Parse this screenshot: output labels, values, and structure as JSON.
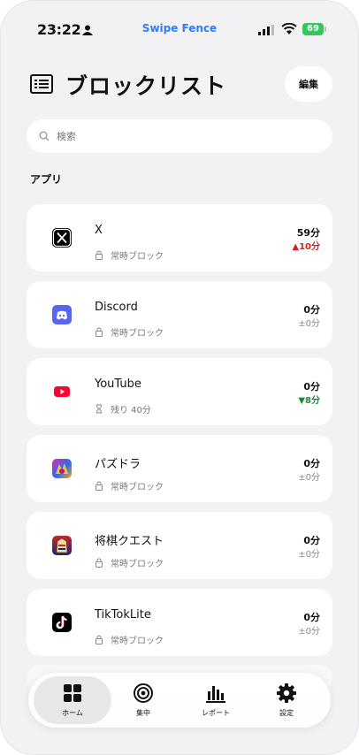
{
  "status_bar": {
    "time": "23:22",
    "carrier_brand": "Swipe Fence",
    "battery": "69",
    "brand_color": "#2e7cf6",
    "battery_color": "#34c759"
  },
  "header": {
    "title": "ブロックリスト",
    "edit_label": "編集"
  },
  "search": {
    "placeholder": "検索"
  },
  "section_label": "アプリ",
  "apps": [
    {
      "name": "X",
      "status": "常時ブロック",
      "status_icon": "lock-icon",
      "value": "59分",
      "delta": "▲10分",
      "delta_dir": "up"
    },
    {
      "name": "Discord",
      "status": "常時ブロック",
      "status_icon": "lock-icon",
      "value": "0分",
      "delta": "±0分",
      "delta_dir": "none"
    },
    {
      "name": "YouTube",
      "status": "残り 40分",
      "status_icon": "hourglass-icon",
      "value": "0分",
      "delta": "▼8分",
      "delta_dir": "down"
    },
    {
      "name": "パズドラ",
      "status": "常時ブロック",
      "status_icon": "lock-icon",
      "value": "0分",
      "delta": "±0分",
      "delta_dir": "none"
    },
    {
      "name": "将棋クエスト",
      "status": "常時ブロック",
      "status_icon": "lock-icon",
      "value": "0分",
      "delta": "±0分",
      "delta_dir": "none"
    },
    {
      "name": "TikTokLite",
      "status": "常時ブロック",
      "status_icon": "lock-icon",
      "value": "0分",
      "delta": "±0分",
      "delta_dir": "none"
    }
  ],
  "tabbar": {
    "home": "ホーム",
    "focus": "集中",
    "report": "レポート",
    "settings": "設定"
  },
  "colors": {
    "up": "#d32020",
    "down": "#1f8a3b",
    "discord": "#5865f2",
    "youtube": "#ff0033"
  }
}
